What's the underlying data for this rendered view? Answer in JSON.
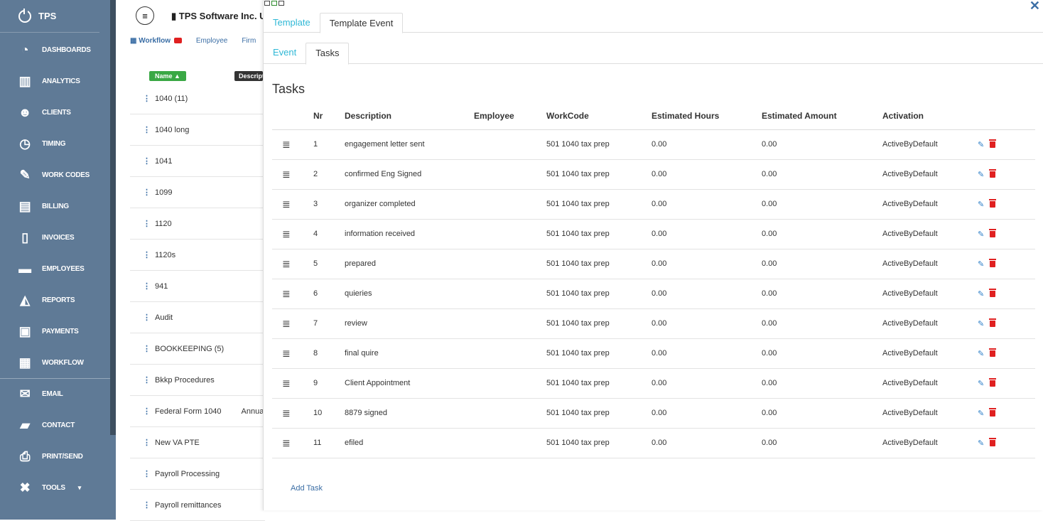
{
  "sidebar": {
    "brand": "TPS",
    "items": [
      {
        "label": "DASHBOARDS",
        "icon": "dashboard-icon"
      },
      {
        "label": "ANALYTICS",
        "icon": "bar-chart-icon"
      },
      {
        "label": "CLIENTS",
        "icon": "users-icon"
      },
      {
        "label": "TIMING",
        "icon": "clock-icon"
      },
      {
        "label": "WORK CODES",
        "icon": "wrench-icon"
      },
      {
        "label": "BILLING",
        "icon": "billing-icon"
      },
      {
        "label": "INVOICES",
        "icon": "invoice-icon"
      },
      {
        "label": "EMPLOYEES",
        "icon": "briefcase-icon"
      },
      {
        "label": "REPORTS",
        "icon": "area-chart-icon"
      },
      {
        "label": "PAYMENTS",
        "icon": "money-icon"
      },
      {
        "label": "WORKFLOW",
        "icon": "calendar-icon"
      },
      {
        "label": "EMAIL",
        "icon": "envelope-icon"
      },
      {
        "label": "CONTACT",
        "icon": "contact-icon"
      },
      {
        "label": "PRINT/SEND",
        "icon": "print-icon"
      },
      {
        "label": "TOOLS",
        "icon": "tools-icon"
      }
    ]
  },
  "header": {
    "company": "TPS Software Inc. U"
  },
  "bg_tabs": {
    "workflow": "Workflow",
    "employee": "Employee",
    "firm": "Firm"
  },
  "bg_table": {
    "name_header": "Name",
    "desc_header": "Descript",
    "rows": [
      {
        "name": "1040 (11)",
        "extra": ""
      },
      {
        "name": "1040 long",
        "extra": ""
      },
      {
        "name": "1041",
        "extra": ""
      },
      {
        "name": "1099",
        "extra": ""
      },
      {
        "name": "1120",
        "extra": ""
      },
      {
        "name": "1120s",
        "extra": ""
      },
      {
        "name": "941",
        "extra": ""
      },
      {
        "name": "Audit",
        "extra": ""
      },
      {
        "name": "BOOKKEEPING (5)",
        "extra": ""
      },
      {
        "name": "Bkkp Procedures",
        "extra": ""
      },
      {
        "name": "Federal Form 1040",
        "extra": "Annual"
      },
      {
        "name": "New VA PTE",
        "extra": ""
      },
      {
        "name": "Payroll Processing",
        "extra": ""
      },
      {
        "name": "Payroll remittances",
        "extra": ""
      }
    ]
  },
  "modal": {
    "tabs": [
      "Template",
      "Template Event"
    ],
    "subtabs": [
      "Event",
      "Tasks"
    ],
    "title": "Tasks",
    "columns": [
      "Nr",
      "Description",
      "Employee",
      "WorkCode",
      "Estimated Hours",
      "Estimated Amount",
      "Activation"
    ],
    "rows": [
      {
        "nr": "1",
        "description": "engagement letter sent",
        "employee": "",
        "workcode": "501 1040 tax prep",
        "hours": "0.00",
        "amount": "0.00",
        "activation": "ActiveByDefault"
      },
      {
        "nr": "2",
        "description": "confirmed Eng Signed",
        "employee": "",
        "workcode": "501 1040 tax prep",
        "hours": "0.00",
        "amount": "0.00",
        "activation": "ActiveByDefault"
      },
      {
        "nr": "3",
        "description": "organizer completed",
        "employee": "",
        "workcode": "501 1040 tax prep",
        "hours": "0.00",
        "amount": "0.00",
        "activation": "ActiveByDefault"
      },
      {
        "nr": "4",
        "description": "information received",
        "employee": "",
        "workcode": "501 1040 tax prep",
        "hours": "0.00",
        "amount": "0.00",
        "activation": "ActiveByDefault"
      },
      {
        "nr": "5",
        "description": "prepared",
        "employee": "",
        "workcode": "501 1040 tax prep",
        "hours": "0.00",
        "amount": "0.00",
        "activation": "ActiveByDefault"
      },
      {
        "nr": "6",
        "description": "quieries",
        "employee": "",
        "workcode": "501 1040 tax prep",
        "hours": "0.00",
        "amount": "0.00",
        "activation": "ActiveByDefault"
      },
      {
        "nr": "7",
        "description": "review",
        "employee": "",
        "workcode": "501 1040 tax prep",
        "hours": "0.00",
        "amount": "0.00",
        "activation": "ActiveByDefault"
      },
      {
        "nr": "8",
        "description": "final quire",
        "employee": "",
        "workcode": "501 1040 tax prep",
        "hours": "0.00",
        "amount": "0.00",
        "activation": "ActiveByDefault"
      },
      {
        "nr": "9",
        "description": "Client Appointment",
        "employee": "",
        "workcode": "501 1040 tax prep",
        "hours": "0.00",
        "amount": "0.00",
        "activation": "ActiveByDefault"
      },
      {
        "nr": "10",
        "description": "8879 signed",
        "employee": "",
        "workcode": "501 1040 tax prep",
        "hours": "0.00",
        "amount": "0.00",
        "activation": "ActiveByDefault"
      },
      {
        "nr": "11",
        "description": "efiled",
        "employee": "",
        "workcode": "501 1040 tax prep",
        "hours": "0.00",
        "amount": "0.00",
        "activation": "ActiveByDefault"
      }
    ],
    "add_task": "Add Task"
  },
  "colors": {
    "sidebar": "#5f7a96",
    "accent": "#2fb8d6",
    "link": "#3b6ea5",
    "delete": "#e02020",
    "name_pill": "#3aa845"
  }
}
